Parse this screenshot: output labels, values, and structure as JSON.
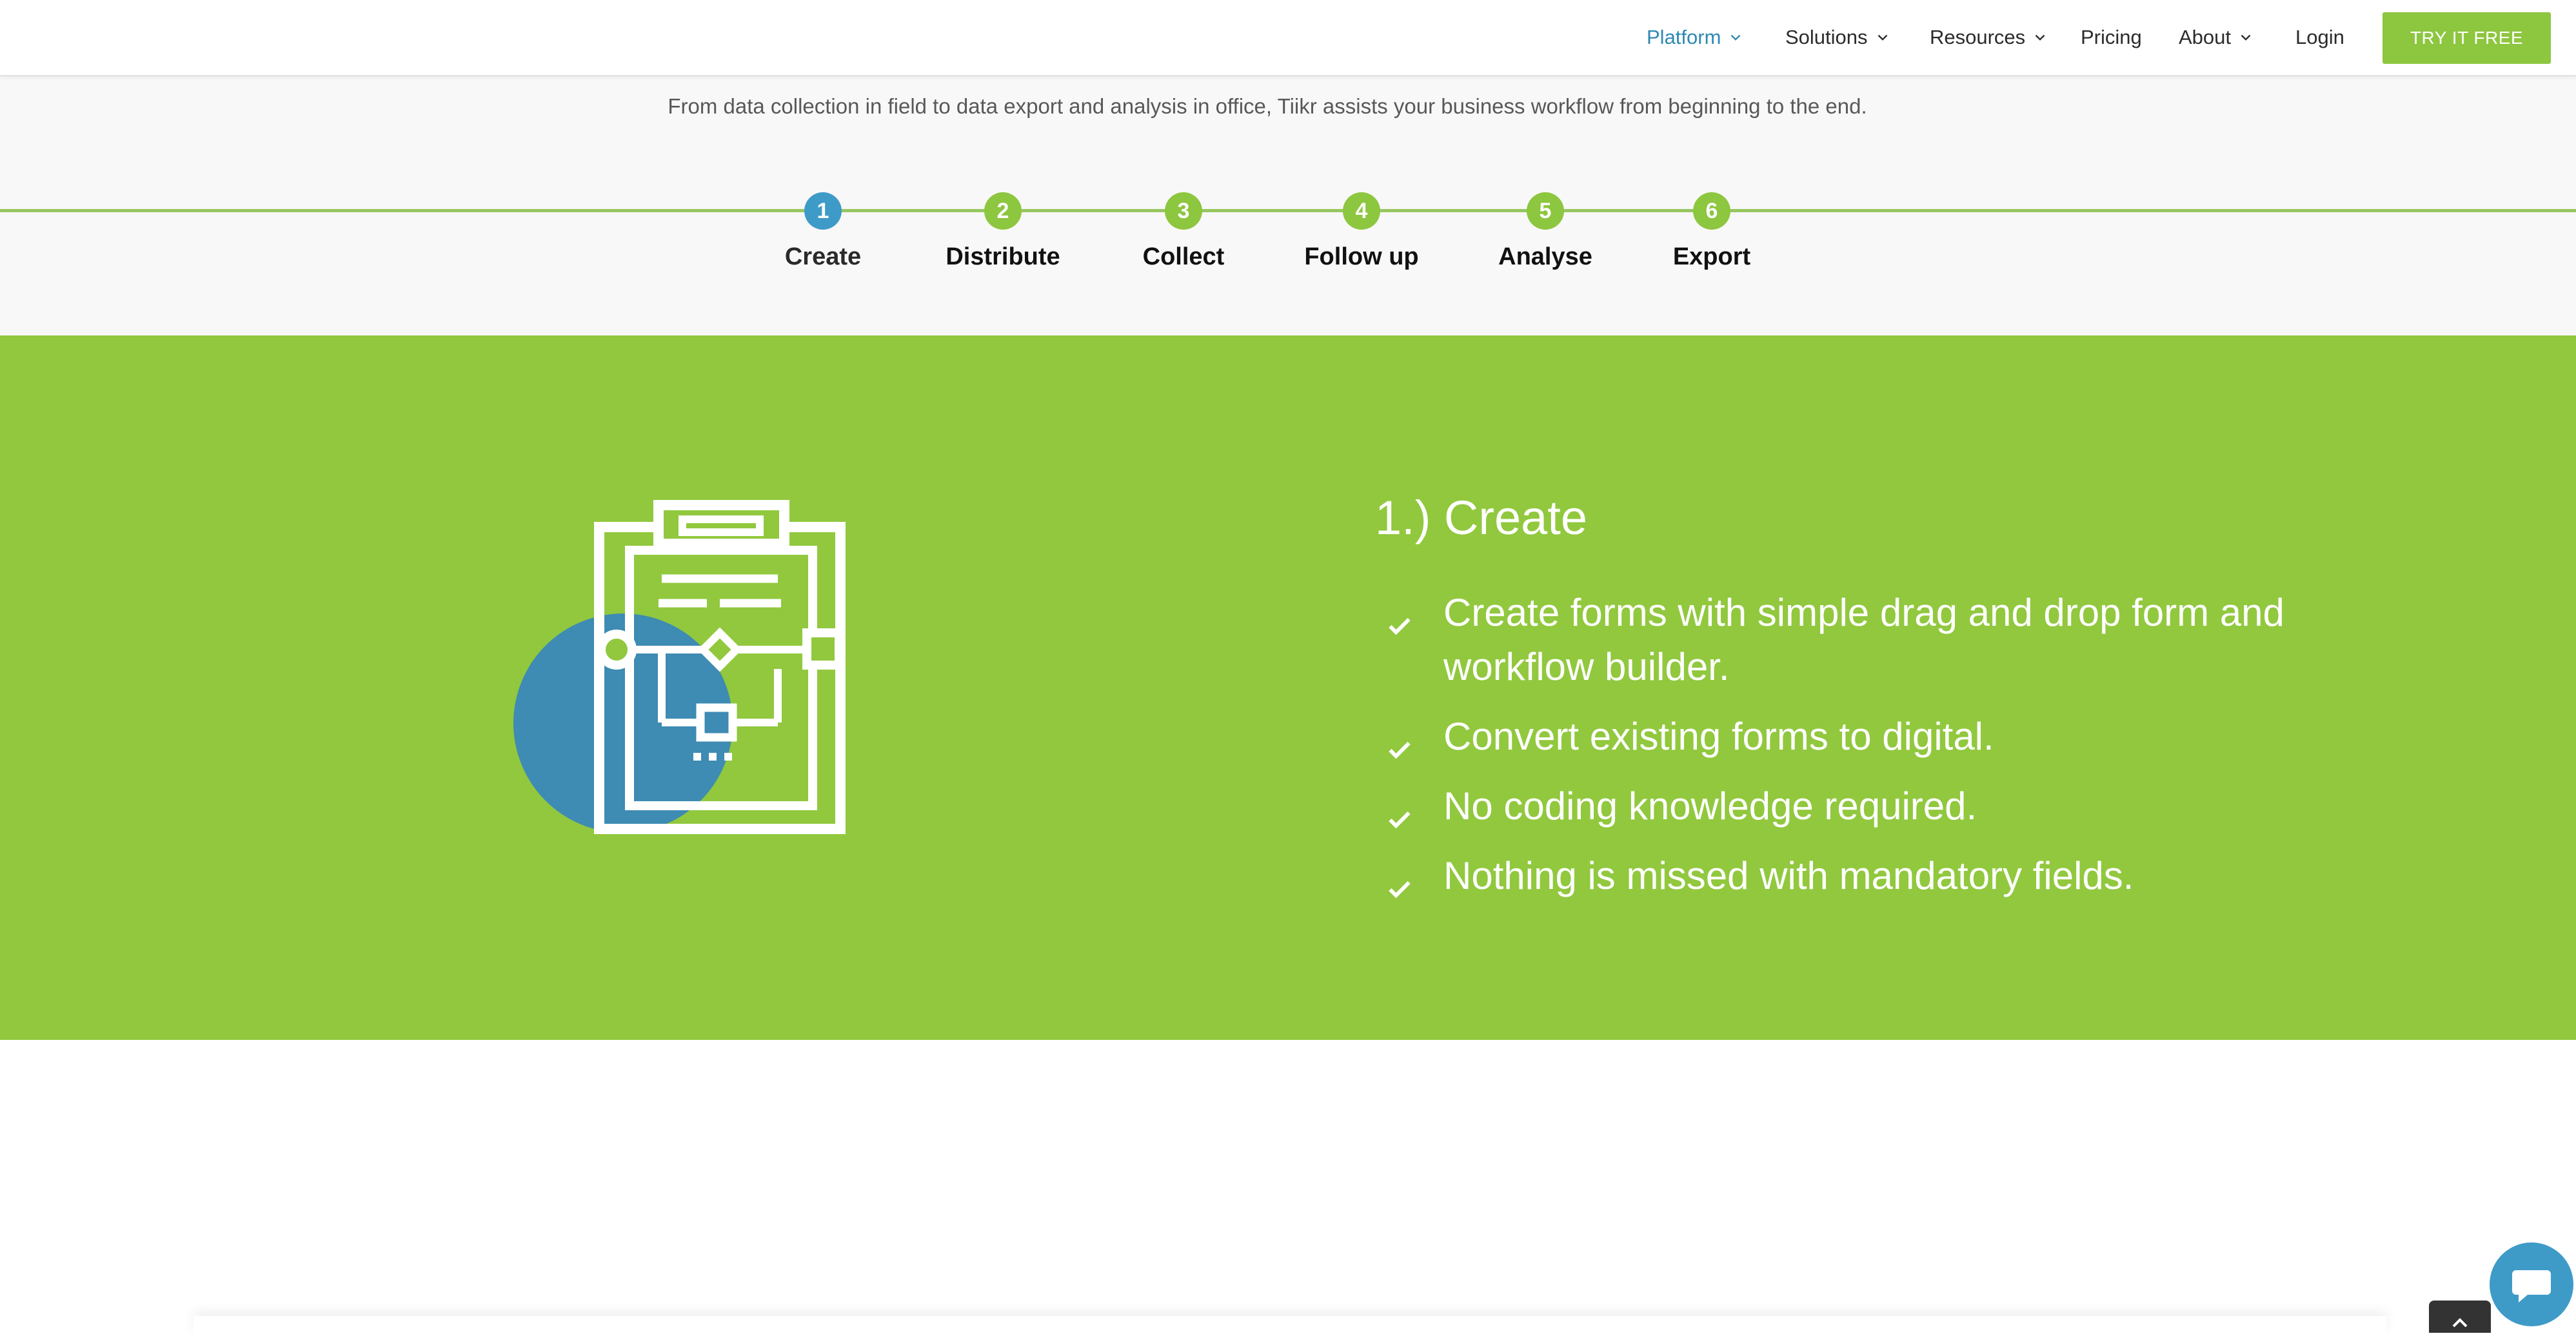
{
  "nav": {
    "items": [
      {
        "label": "Platform",
        "has_dropdown": true,
        "active": true
      },
      {
        "label": "Solutions",
        "has_dropdown": true,
        "active": false
      },
      {
        "label": "Resources",
        "has_dropdown": true,
        "active": false
      },
      {
        "label": "Pricing",
        "has_dropdown": false,
        "active": false
      },
      {
        "label": "About",
        "has_dropdown": true,
        "active": false
      },
      {
        "label": "Login",
        "has_dropdown": false,
        "active": false
      }
    ],
    "cta_label": "TRY IT FREE"
  },
  "steps_section": {
    "subtitle": "From data collection in field to data export and analysis in office, Tiikr assists your business workflow from beginning to the end.",
    "steps": [
      {
        "number": "1",
        "label": "Create",
        "active": true
      },
      {
        "number": "2",
        "label": "Distribute",
        "active": false
      },
      {
        "number": "3",
        "label": "Collect",
        "active": false
      },
      {
        "number": "4",
        "label": "Follow up",
        "active": false
      },
      {
        "number": "5",
        "label": "Analyse",
        "active": false
      },
      {
        "number": "6",
        "label": "Export",
        "active": false
      }
    ]
  },
  "content": {
    "title": "1.) Create",
    "bullets": [
      "Create forms with simple drag and drop form and workflow builder.",
      "Convert existing forms to digital.",
      "No coding knowledge required.",
      "Nothing is missed with mandatory fields."
    ],
    "illustration_icon": "clipboard-workflow-icon",
    "bullet_icon": "check-icon"
  },
  "widgets": {
    "chat_icon": "chat-bubble-icon",
    "scroll_top_icon": "chevron-up-icon"
  },
  "colors": {
    "accent_blue": "#3e9bc8",
    "brand_green": "#8dc63f",
    "section_green": "#91c83e",
    "nav_active": "#2e89b3"
  }
}
